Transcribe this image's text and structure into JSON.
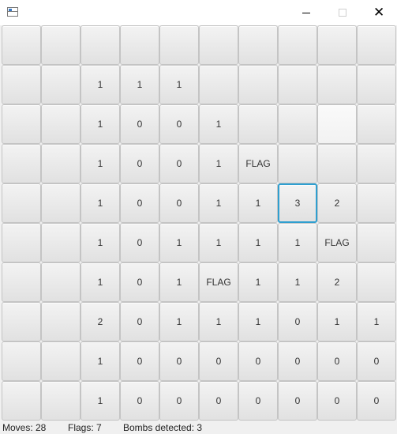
{
  "window": {
    "title": "",
    "icon": "app-window-icon",
    "controls": [
      "minimize-icon",
      "maximize-icon",
      "close-icon"
    ],
    "close_glyph": "✕"
  },
  "board": {
    "rows": [
      [
        "",
        "",
        "",
        "",
        "",
        "",
        "",
        "",
        "",
        ""
      ],
      [
        "",
        "",
        "1",
        "1",
        "1",
        "",
        "",
        "",
        "",
        ""
      ],
      [
        "",
        "",
        "1",
        "0",
        "0",
        "1",
        "",
        "",
        "",
        ""
      ],
      [
        "",
        "",
        "1",
        "0",
        "0",
        "1",
        "FLAG",
        "",
        "",
        ""
      ],
      [
        "",
        "",
        "1",
        "0",
        "0",
        "1",
        "1",
        "3",
        "2",
        ""
      ],
      [
        "",
        "",
        "1",
        "0",
        "1",
        "1",
        "1",
        "1",
        "FLAG",
        ""
      ],
      [
        "",
        "",
        "1",
        "0",
        "1",
        "FLAG",
        "1",
        "1",
        "2",
        ""
      ],
      [
        "",
        "",
        "2",
        "0",
        "1",
        "1",
        "1",
        "0",
        "1",
        "1"
      ],
      [
        "",
        "",
        "1",
        "0",
        "0",
        "0",
        "0",
        "0",
        "0",
        "0"
      ],
      [
        "",
        "",
        "1",
        "0",
        "0",
        "0",
        "0",
        "0",
        "0",
        "0"
      ]
    ],
    "selected_cell": [
      4,
      7
    ],
    "hover_cell": [
      2,
      8
    ],
    "selection_color": "#2f9fd0"
  },
  "status": {
    "moves": "Moves: 28",
    "flags": "Flags: 7",
    "bombs": "Bombs detected: 3"
  }
}
